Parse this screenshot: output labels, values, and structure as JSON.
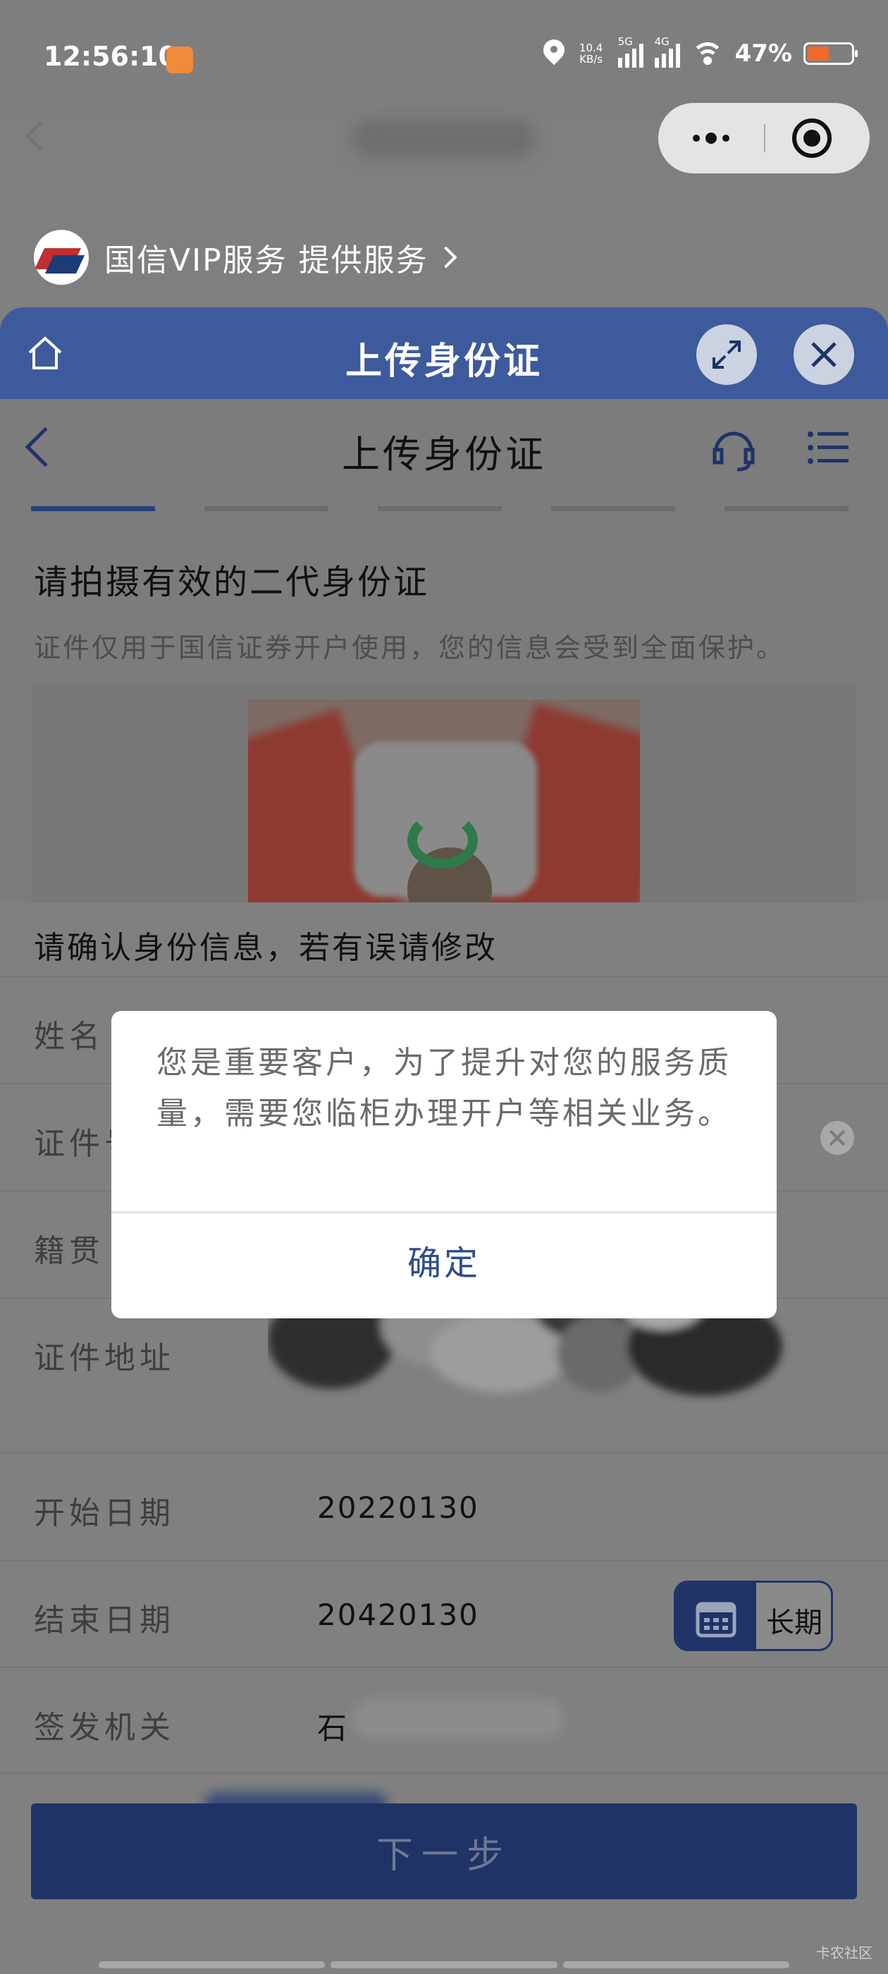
{
  "status_bar": {
    "time": "12:56:10",
    "net_speed": "10.4 KB/s",
    "signal_1": "5G",
    "signal_2": "4G",
    "battery": "47%"
  },
  "provider": {
    "text": "国信VIP服务 提供服务"
  },
  "header": {
    "title": "上传身份证"
  },
  "page": {
    "title": "上传身份证",
    "heading": "请拍摄有效的二代身份证",
    "note": "证件仅用于国信证券开户使用，您的信息会受到全面保护。"
  },
  "form": {
    "title": "请确认身份信息，若有误请修改",
    "fields": [
      {
        "label": "姓名",
        "value": ""
      },
      {
        "label": "证件号码",
        "value": ""
      },
      {
        "label": "籍贯",
        "value": ""
      },
      {
        "label": "证件地址",
        "value": ""
      },
      {
        "label": "开始日期",
        "value": "20220130"
      },
      {
        "label": "结束日期",
        "value": "20420130"
      },
      {
        "label": "签发机关",
        "value": "石"
      }
    ],
    "long_term_label": "长期",
    "next_label": "下一步"
  },
  "modal": {
    "message": "您是重要客户，为了提升对您的服务质量，需要您临柜办理开户等相关业务。",
    "ok_label": "确定"
  },
  "watermark": "卡农社区",
  "colors": {
    "brand_blue": "#3d5a9c",
    "dark_blue": "#1f3366",
    "link_blue": "#2d4c8c"
  }
}
